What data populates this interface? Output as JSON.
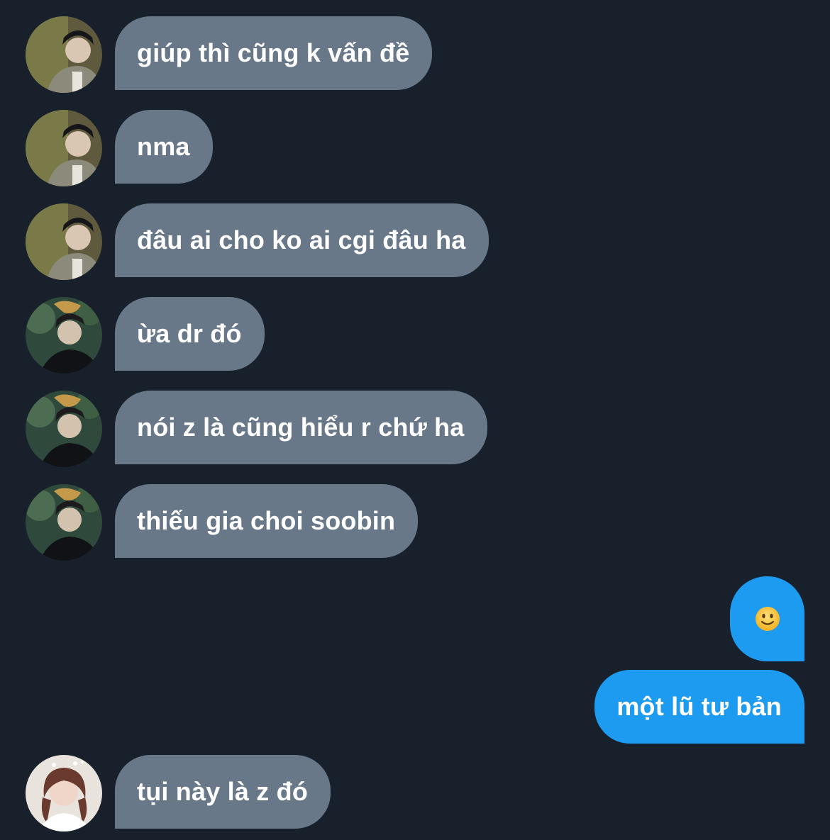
{
  "conversation": {
    "messages": [
      {
        "direction": "incoming",
        "sender_avatar": "avatar-a",
        "text": "giúp thì cũng k vấn đề"
      },
      {
        "direction": "incoming",
        "sender_avatar": "avatar-a",
        "text": "nma"
      },
      {
        "direction": "incoming",
        "sender_avatar": "avatar-a",
        "text": "đâu ai cho ko ai cgi đâu ha"
      },
      {
        "direction": "incoming",
        "sender_avatar": "avatar-b",
        "text": "ừa dr đó"
      },
      {
        "direction": "incoming",
        "sender_avatar": "avatar-b",
        "text": "nói z là cũng hiểu r chứ ha"
      },
      {
        "direction": "incoming",
        "sender_avatar": "avatar-b",
        "text": "thiếu gia choi soobin"
      },
      {
        "direction": "outgoing",
        "text": "",
        "emoji": "slightly-smiling-face"
      },
      {
        "direction": "outgoing",
        "text": "một lũ tư bản"
      },
      {
        "direction": "incoming",
        "sender_avatar": "avatar-c",
        "text": "tụi này là z đó"
      }
    ]
  },
  "colors": {
    "background": "#17202b",
    "incoming_bubble": "#687888",
    "outgoing_bubble": "#1d9bf0",
    "text": "#ffffff"
  }
}
